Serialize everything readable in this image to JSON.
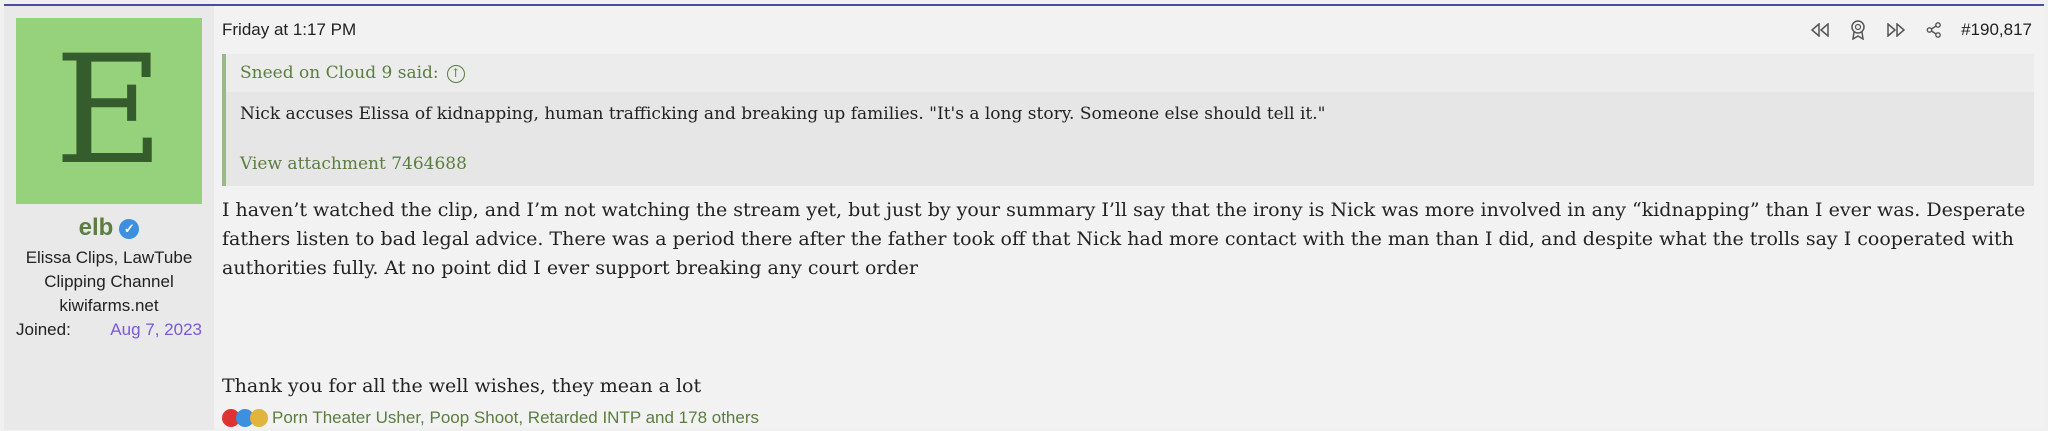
{
  "user": {
    "avatar_letter": "E",
    "avatar_color": "#96d27b",
    "username": "elb",
    "verified_icon": "verified-badge-icon",
    "title_lines": [
      "Elissa Clips, LawTube",
      "Clipping Channel",
      "kiwifarms.net"
    ],
    "joined_label": "Joined:",
    "joined_value": "Aug 7, 2023"
  },
  "post": {
    "date": "Friday at 1:17 PM",
    "number": "#190,817",
    "tools": [
      "rewind-icon",
      "award-icon",
      "fast-forward-icon",
      "share-icon"
    ],
    "quote": {
      "author_line": "Sneed on Cloud 9 said:",
      "text": "Nick accuses Elissa of kidnapping, human trafficking and breaking up families. \"It's a long story. Someone else should tell it.\"",
      "attachment": "View attachment 7464688"
    },
    "body_p1": "I haven’t watched the clip, and I’m not watching the stream yet, but just by your summary I’ll say that the irony is Nick was more involved in any “kidnapping” than I ever was. Desperate fathers listen to bad legal advice. There was a period there after the father took off that Nick had more contact with the man than I did, and despite what the trolls say I cooperated with authorities fully. At no point did I ever support breaking any court order",
    "body_p2": "Thank you for all the well wishes, they mean a lot",
    "reactions_text": "Porn Theater Usher, Poop Shoot, Retarded INTP and 178 others"
  }
}
